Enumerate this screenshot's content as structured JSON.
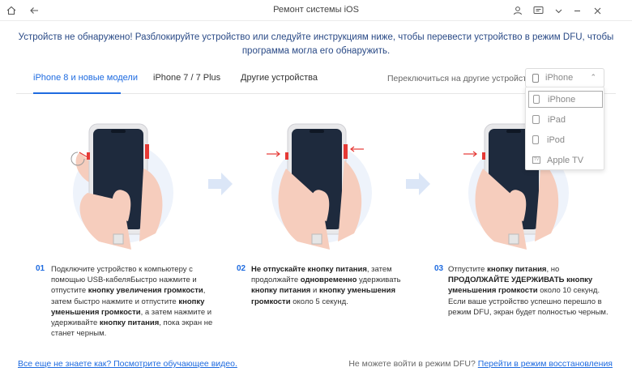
{
  "window": {
    "title": "Ремонт системы iOS",
    "icons": [
      "home-icon",
      "back-icon",
      "user-icon",
      "feedback-icon",
      "dropdown-icon",
      "minimize-icon",
      "close-icon"
    ]
  },
  "notice": "Устройств не обнаружено! Разблокируйте устройство или следуйте инструкциям ниже, чтобы перевести устройство в режим DFU, чтобы программа могла его обнаружить.",
  "tabs": [
    {
      "label": "iPhone 8 и новые модели",
      "active": true
    },
    {
      "label": "iPhone 7 / 7 Plus",
      "active": false
    },
    {
      "label": "Другие устройства",
      "active": false
    }
  ],
  "device_switch": {
    "label": "Переключиться на другие устройства:",
    "selected": "iPhone",
    "options": [
      "iPhone",
      "iPad",
      "iPod",
      "Apple TV"
    ],
    "tv_icon_text": "TV"
  },
  "steps": [
    {
      "number": "01",
      "parts": [
        {
          "t": "Подключите устройство к компьютеру с помощью USB-кабеляБыстро нажмите и отпустите ",
          "b": false
        },
        {
          "t": "кнопку увеличения громкости",
          "b": true
        },
        {
          "t": ", затем быстро нажмите и отпустите ",
          "b": false
        },
        {
          "t": "кнопку уменьшения громкости",
          "b": true
        },
        {
          "t": ", а затем нажмите и удерживайте ",
          "b": false
        },
        {
          "t": "кнопку питания",
          "b": true
        },
        {
          "t": ", пока экран не станет черным.",
          "b": false
        }
      ]
    },
    {
      "number": "02",
      "parts": [
        {
          "t": "Не отпускайте кнопку питания",
          "b": true
        },
        {
          "t": ", затем продолжайте ",
          "b": false
        },
        {
          "t": "одновременно",
          "b": true
        },
        {
          "t": " удерживать ",
          "b": false
        },
        {
          "t": "кнопку питания",
          "b": true
        },
        {
          "t": " и ",
          "b": false
        },
        {
          "t": "кнопку уменьшения громкости",
          "b": true
        },
        {
          "t": " около 5 секунд.",
          "b": false
        }
      ]
    },
    {
      "number": "03",
      "parts": [
        {
          "t": "Отпустите ",
          "b": false
        },
        {
          "t": "кнопку питания",
          "b": true
        },
        {
          "t": ", но ",
          "b": false
        },
        {
          "t": "ПРОДОЛЖАЙТЕ УДЕРЖИВАТЬ кнопку уменьшения громкости",
          "b": true
        },
        {
          "t": " около 10 секунд. Если ваше устройство успешно перешло в режим DFU, экран будет полностью черным.",
          "b": false
        }
      ]
    }
  ],
  "footer": {
    "left_link": "Все еще не знаете как? Посмотрите обучающее видео.",
    "right_text": "Не можете войти в режим DFU? ",
    "right_link": "Перейти в режим восстановления"
  },
  "colors": {
    "accent": "#1e6be0",
    "notice": "#2a4a86",
    "button_highlight": "#e53935"
  }
}
